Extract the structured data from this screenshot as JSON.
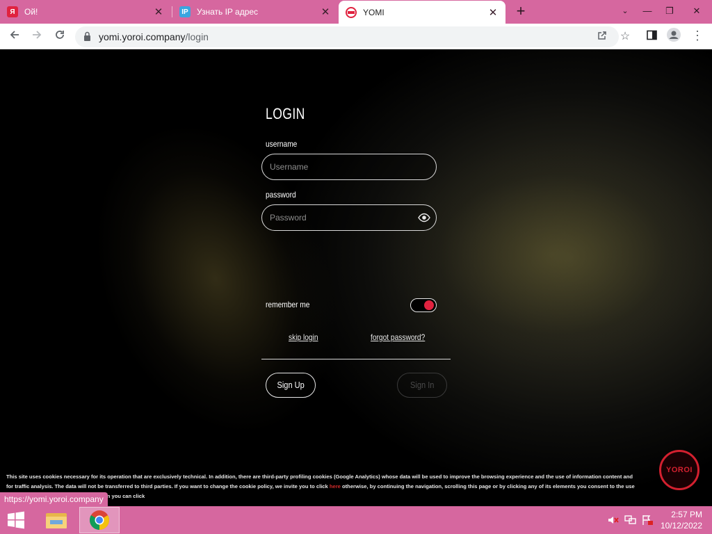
{
  "browser": {
    "tabs": [
      {
        "title": "Ой!",
        "favicon": "yandex-icon",
        "favicon_color": "#e0223f",
        "favicon_text": "Я",
        "active": false
      },
      {
        "title": "Узнать IP адрес",
        "favicon": "ip-icon",
        "favicon_color": "#3aa5e0",
        "favicon_text": "IP",
        "active": false
      },
      {
        "title": "YOMI",
        "favicon": "yomi-icon",
        "favicon_color": "#e0223f",
        "favicon_text": "",
        "active": true
      }
    ],
    "url_host": "yomi.yoroi.company",
    "url_path": "/login",
    "accent_color": "#d6679f"
  },
  "login": {
    "title": "LOGIN",
    "username_label": "username",
    "username_placeholder": "Username",
    "password_label": "password",
    "password_placeholder": "Password",
    "remember_label": "remember me",
    "remember_checked": true,
    "skip_login": "skip login",
    "forgot_password": "forgot password?",
    "sign_up": "Sign Up",
    "sign_in": "Sign In",
    "toggle_color": "#e0223f"
  },
  "cookie_notice": {
    "text_before": "This site uses cookies necessary for its operation that are exclusively technical. In addition, there are third-party profiling cookies (Google Analytics) whose data will be used to improve the browsing experience and the use of information content and for traffic analysis. The data will not be transferred to third parties. If you want to change the cookie policy, we invite you to click ",
    "link_text": "here",
    "text_after": " otherwise, by continuing the navigation, scrolling this page or by clicking any of its elements you consent to the use of cookies. For more detailed information you can click"
  },
  "logo_text": "YOROI",
  "status_url": "https://yomi.yoroi.company",
  "taskbar": {
    "time": "2:57 PM",
    "date": "10/12/2022"
  }
}
